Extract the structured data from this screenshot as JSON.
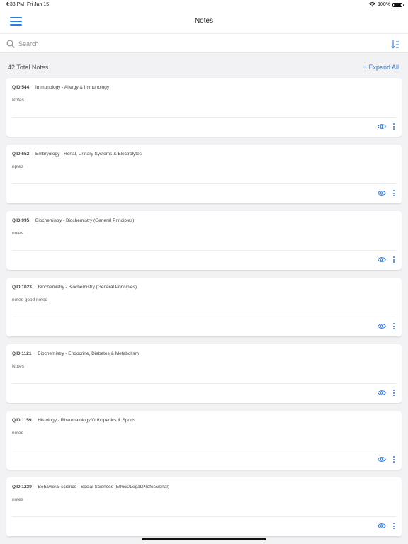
{
  "status_bar": {
    "time": "4:38 PM",
    "date": "Fri Jan 15",
    "battery": "100%",
    "icons": [
      "wifi-icon",
      "battery-icon"
    ]
  },
  "nav": {
    "title": "Notes",
    "menu_icon": "hamburger-menu-icon"
  },
  "search": {
    "placeholder": "Search",
    "value": "",
    "sort_icon": "sort-icon"
  },
  "summary": {
    "total": "42 Total Notes",
    "expand": "+ Expand All"
  },
  "colors": {
    "accent": "#2c7be0",
    "background": "#f2f2f4",
    "card": "#ffffff"
  },
  "notes": [
    {
      "qid": "QID 544",
      "topic": "Immunology - Allergy & Immunology",
      "body": "Notes"
    },
    {
      "qid": "QID 652",
      "topic": "Embryology - Renal, Urinary Systems & Electrolytes",
      "body": "nptes"
    },
    {
      "qid": "QID 995",
      "topic": "Biochemistry - Biochemistry (General Principles)",
      "body": "notes"
    },
    {
      "qid": "QID 1023",
      "topic": "Biochemistry - Biochemistry (General Principles)",
      "body": "notes good noted"
    },
    {
      "qid": "QID 1121",
      "topic": "Biochemistry - Endocrine, Diabetes & Metabolism",
      "body": "Notes"
    },
    {
      "qid": "QID 1159",
      "topic": "Histology - Rheumatology/Orthopedics & Sports",
      "body": "notes"
    },
    {
      "qid": "QID 1239",
      "topic": "Behavioral science - Social Sciences (Ethics/Legal/Professional)",
      "body": "notes"
    }
  ]
}
